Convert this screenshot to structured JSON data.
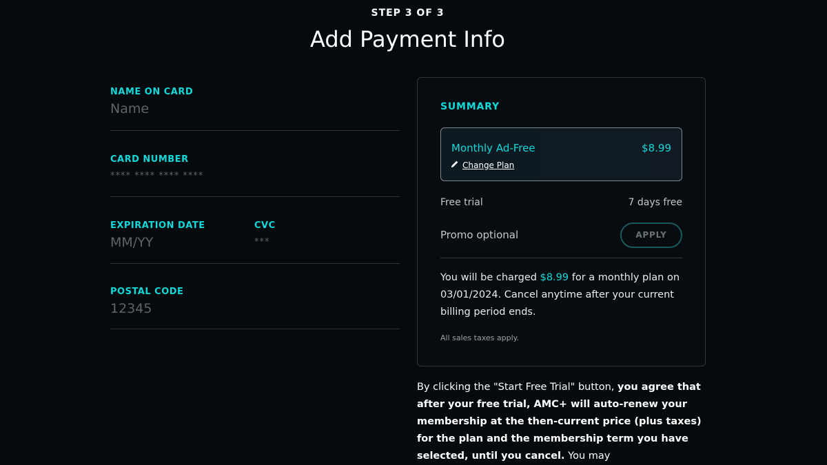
{
  "header": {
    "step": "STEP 3 OF 3",
    "title": "Add Payment Info"
  },
  "form": {
    "name_label": "NAME ON CARD",
    "name_placeholder": "Name",
    "card_label": "CARD NUMBER",
    "card_placeholder": "**** **** **** ****",
    "exp_label": "EXPIRATION DATE",
    "exp_placeholder": "MM/YY",
    "cvc_label": "CVC",
    "cvc_placeholder": "***",
    "postal_label": "POSTAL CODE",
    "postal_placeholder": "12345"
  },
  "summary": {
    "label": "SUMMARY",
    "plan_name": "Monthly Ad-Free",
    "plan_price": "$8.99",
    "change_plan": "Change Plan",
    "trial_label": "Free trial",
    "trial_value": "7 days free",
    "promo_label": "Promo optional",
    "apply_label": "APPLY",
    "charge_pre": "You will be charged ",
    "charge_amount": "$8.99",
    "charge_post": " for a monthly plan on 03/01/2024. Cancel anytime after your current billing period ends.",
    "tax_note": "All sales taxes apply."
  },
  "legal": {
    "part1": "By clicking the \"Start Free Trial\" button, ",
    "bold": "you agree that after your free trial, AMC+ will auto-renew your membership at the then-current price (plus taxes) for the plan and the membership term you have selected, until you cancel.",
    "part2": " You may"
  },
  "colors": {
    "background": "#050a0e",
    "accent": "#12d8d8",
    "border": "#2f363c"
  }
}
